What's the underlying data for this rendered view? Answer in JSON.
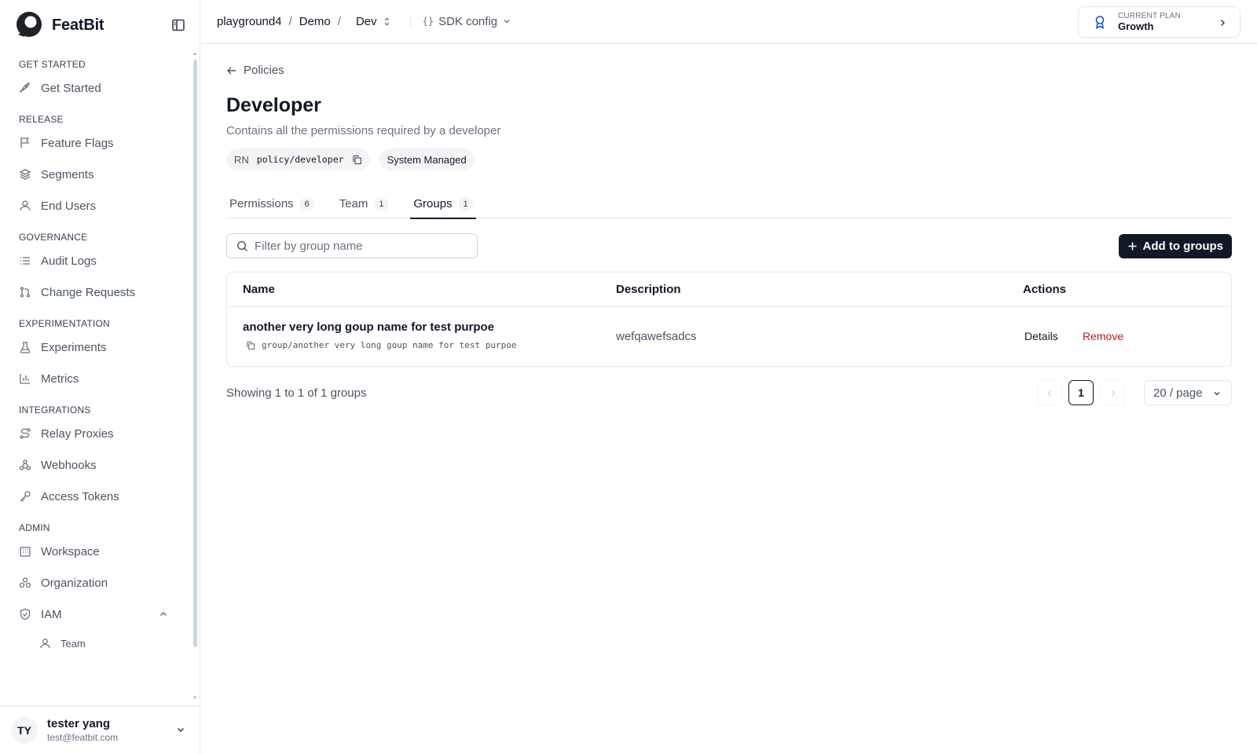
{
  "brand": {
    "name": "FeatBit"
  },
  "sidebar": {
    "sections": [
      {
        "title": "GET STARTED",
        "items": [
          {
            "label": "Get Started",
            "icon": "rocket-icon"
          }
        ]
      },
      {
        "title": "RELEASE",
        "items": [
          {
            "label": "Feature Flags",
            "icon": "flag-icon"
          },
          {
            "label": "Segments",
            "icon": "layers-icon"
          },
          {
            "label": "End Users",
            "icon": "user-icon"
          }
        ]
      },
      {
        "title": "GOVERNANCE",
        "items": [
          {
            "label": "Audit Logs",
            "icon": "list-icon"
          },
          {
            "label": "Change Requests",
            "icon": "git-pull-request-icon"
          }
        ]
      },
      {
        "title": "EXPERIMENTATION",
        "items": [
          {
            "label": "Experiments",
            "icon": "flask-icon"
          },
          {
            "label": "Metrics",
            "icon": "bar-chart-icon"
          }
        ]
      },
      {
        "title": "INTEGRATIONS",
        "items": [
          {
            "label": "Relay Proxies",
            "icon": "route-icon"
          },
          {
            "label": "Webhooks",
            "icon": "webhook-icon"
          },
          {
            "label": "Access Tokens",
            "icon": "key-icon"
          }
        ]
      },
      {
        "title": "ADMIN",
        "items": [
          {
            "label": "Workspace",
            "icon": "building-icon"
          },
          {
            "label": "Organization",
            "icon": "organization-icon"
          },
          {
            "label": "IAM",
            "icon": "shield-icon"
          }
        ]
      }
    ],
    "iam_sub": {
      "label": "Team",
      "icon": "user-icon"
    },
    "user": {
      "initials": "TY",
      "name": "tester yang",
      "email": "test@featbit.com"
    }
  },
  "topbar": {
    "project": "playground4",
    "sep": "/",
    "env_group": "Demo",
    "env": "Dev",
    "sdk_braces": "{}",
    "sdk_label": "SDK config",
    "plan_label": "CURRENT PLAN",
    "plan_value": "Growth"
  },
  "page": {
    "back_label": "Policies",
    "title": "Developer",
    "description": "Contains all the permissions required by a developer",
    "rn_label": "RN",
    "rn_value": "policy/developer",
    "managed_badge": "System Managed",
    "tabs": [
      {
        "label": "Permissions",
        "count": "6"
      },
      {
        "label": "Team",
        "count": "1"
      },
      {
        "label": "Groups",
        "count": "1"
      }
    ],
    "filter_placeholder": "Filter by group name",
    "add_button": "Add to groups",
    "table": {
      "headers": {
        "name": "Name",
        "description": "Description",
        "actions": "Actions"
      },
      "rows": [
        {
          "name": "another very long goup name for test purpoe",
          "rn": "group/another very long goup name for test purpoe",
          "description": "wefqawefsadcs",
          "details": "Details",
          "remove": "Remove"
        }
      ]
    },
    "showing": "Showing 1 to 1 of 1 groups",
    "current_page": "1",
    "per_page": "20 / page"
  },
  "colors": {
    "accent": "#111827",
    "danger": "#b91c1c",
    "plan_icon": "#1d4ed8"
  }
}
